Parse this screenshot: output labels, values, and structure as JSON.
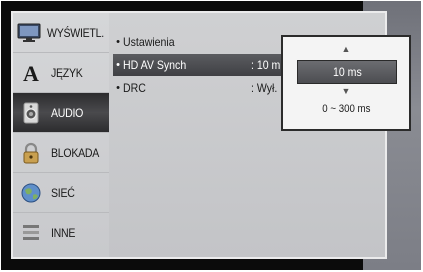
{
  "sidebar": {
    "items": [
      {
        "label": "WYŚWIETL.",
        "icon": "monitor-icon"
      },
      {
        "label": "JĘZYK",
        "icon": "letter-a-icon"
      },
      {
        "label": "AUDIO",
        "icon": "speaker-icon"
      },
      {
        "label": "BLOKADA",
        "icon": "padlock-icon"
      },
      {
        "label": "SIEĆ",
        "icon": "globe-icon"
      },
      {
        "label": "INNE",
        "icon": "list-icon"
      }
    ],
    "active_index": 2
  },
  "settings": {
    "rows": [
      {
        "name": "Ustawienia",
        "value": ""
      },
      {
        "name": "HD AV Synch",
        "value": ": 10 m"
      },
      {
        "name": "DRC",
        "value": ": Wył."
      }
    ]
  },
  "popup": {
    "value": "10 ms",
    "range": "0 ~ 300 ms",
    "up": "▲",
    "down": "▼"
  },
  "colors": {
    "selected": "#46474b",
    "panel": "#cacbce",
    "frame": "#0b0b0b"
  }
}
